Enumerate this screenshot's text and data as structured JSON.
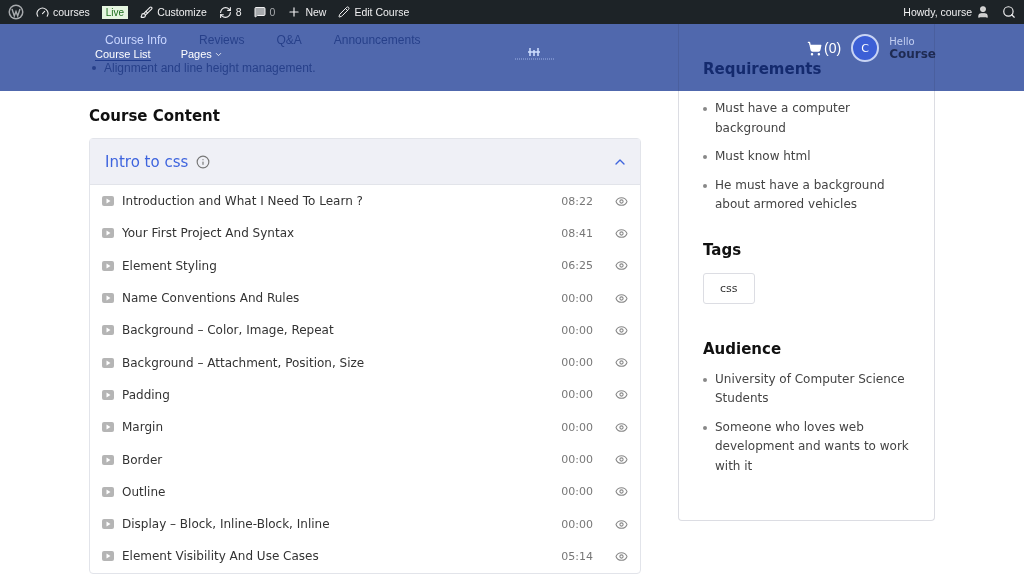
{
  "admin_bar": {
    "site": "courses",
    "live_badge": "Live",
    "customize": "Customize",
    "updates": "8",
    "comments": "0",
    "new": "New",
    "edit": "Edit Course",
    "greeting": "Howdy, course"
  },
  "header": {
    "tabs": [
      {
        "label": "Course Info",
        "selected": true
      },
      {
        "label": "Reviews",
        "selected": false
      },
      {
        "label": "Q&A",
        "selected": false
      },
      {
        "label": "Announcements",
        "selected": false
      }
    ],
    "nav": [
      {
        "label": "Course List",
        "has_menu": false
      },
      {
        "label": "Pages",
        "has_menu": true
      }
    ],
    "cart": "(0)",
    "avatar_initial": "C",
    "hello": "Hello",
    "user": "Course"
  },
  "bullet": "Alignment and line height management.",
  "content_heading": "Course Content",
  "topic": {
    "title": "Intro to css",
    "expanded": true,
    "lessons": [
      {
        "title": "Introduction and What I Need To Learn ?",
        "duration": "08:22"
      },
      {
        "title": "Your First Project And Syntax",
        "duration": "08:41"
      },
      {
        "title": "Element Styling",
        "duration": "06:25"
      },
      {
        "title": "Name Conventions And Rules",
        "duration": "00:00"
      },
      {
        "title": "Background – Color, Image, Repeat",
        "duration": "00:00"
      },
      {
        "title": "Background – Attachment, Position, Size",
        "duration": "00:00"
      },
      {
        "title": "Padding",
        "duration": "00:00"
      },
      {
        "title": "Margin",
        "duration": "00:00"
      },
      {
        "title": "Border",
        "duration": "00:00"
      },
      {
        "title": "Outline",
        "duration": "00:00"
      },
      {
        "title": "Display – Block, Inline-Block, Inline",
        "duration": "00:00"
      },
      {
        "title": "Element Visibility And Use Cases",
        "duration": "05:14"
      }
    ]
  },
  "sidebar": {
    "requirements": {
      "title": "Requirements",
      "items": [
        "Must have a computer background",
        "Must know html",
        "He must have a background about armored vehicles"
      ]
    },
    "tags": {
      "title": "Tags",
      "items": [
        "css"
      ]
    },
    "audience": {
      "title": "Audience",
      "items": [
        "University of Computer Science Students",
        "Someone who loves web development and wants to work with it"
      ]
    }
  }
}
